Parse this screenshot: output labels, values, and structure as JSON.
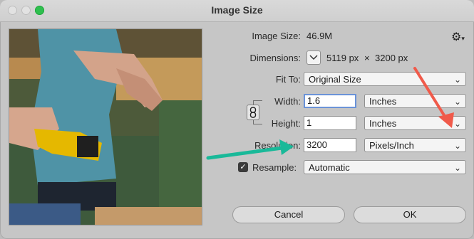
{
  "window": {
    "title": "Image Size"
  },
  "image_size": {
    "label": "Image Size:",
    "value": "46.9M"
  },
  "dimensions": {
    "label": "Dimensions:",
    "width_value": "5119 px",
    "separator": "×",
    "height_value": "3200 px"
  },
  "fit_to": {
    "label": "Fit To:",
    "selected": "Original Size"
  },
  "width": {
    "label": "Width:",
    "value": "1.6",
    "unit": "Inches"
  },
  "height": {
    "label": "Height:",
    "value": "1",
    "unit": "Inches"
  },
  "resolution": {
    "label": "Resolution:",
    "value": "3200",
    "unit": "Pixels/Inch"
  },
  "resample": {
    "label": "Resample:",
    "checked": true,
    "selected": "Automatic"
  },
  "buttons": {
    "cancel": "Cancel",
    "ok": "OK"
  },
  "colors": {
    "arrow_red": "#f05a4a",
    "arrow_green": "#19b999",
    "focus_border": "#6b93d8"
  },
  "icons": [
    "gear-icon",
    "chevron-down-icon",
    "link-chain-icon",
    "checkmark-icon"
  ]
}
